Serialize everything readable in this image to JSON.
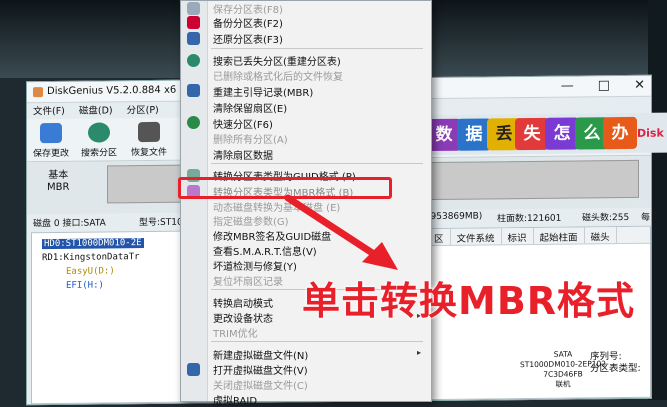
{
  "window": {
    "title": "DiskGenius V5.2.0.884 x6",
    "menus": [
      "文件(F)",
      "磁盘(D)",
      "分区(P)"
    ],
    "win_controls": [
      "—",
      "□",
      "✕"
    ]
  },
  "toolbar": {
    "buttons": [
      {
        "label": "保存更改",
        "icon": "save-icon",
        "color": "#3a7bd5"
      },
      {
        "label": "搜索分区",
        "icon": "magnifier-icon",
        "color": "#2a8a6a"
      },
      {
        "label": "恢复文件",
        "icon": "recover-icon",
        "color": "#555555"
      }
    ]
  },
  "banner": {
    "tiles": [
      {
        "text": "数",
        "color": "#8a3bb5"
      },
      {
        "text": "据",
        "color": "#2a73c9"
      },
      {
        "text": "丢",
        "color": "#e2b000"
      },
      {
        "text": "失",
        "color": "#e23a3a"
      },
      {
        "text": "怎",
        "color": "#7a3bd5"
      },
      {
        "text": "么",
        "color": "#2a9a4a"
      },
      {
        "text": "办",
        "color": "#e85a1a"
      }
    ],
    "brand": "Disk"
  },
  "disk": {
    "label_line1": "基本",
    "label_line2": "MBR"
  },
  "infoline": {
    "disk": "磁盘 0 接口:SATA",
    "model": "型号:ST100(",
    "sectors": "(953869MB)",
    "cylinders": "柱面数:121601",
    "heads": "磁头数:255",
    "more": "每"
  },
  "tree": {
    "nodes": [
      {
        "text": "HD0:ST1000DM010-2E",
        "color": "#ffffff",
        "bg": "#2255aa"
      },
      {
        "text": "RD1:KingstonDataTr",
        "color": "#000000",
        "bg": "transparent"
      },
      {
        "text": "EasyU(D:)",
        "color": "#b08a00",
        "bg": "transparent"
      },
      {
        "text": "EFI(H:)",
        "color": "#1a5ac0",
        "bg": "transparent"
      }
    ]
  },
  "panel": {
    "tabs": [
      "区",
      "文件系统",
      "标识",
      "起始柱面",
      "磁头"
    ],
    "sata_label": "SATA",
    "sata_model": "ST1000DM010-2EP102",
    "sata_serial": "7C3D46FB",
    "sata_status": "联机",
    "serial_label": "序列号:",
    "part_table_label": "分区表类型:"
  },
  "menu": {
    "items": [
      {
        "label": "保存分区表(F8)",
        "disabled": true,
        "icon": "save-icon",
        "icolor": "#9ab"
      },
      {
        "label": "备份分区表(F2)",
        "disabled": false,
        "icon": "backup-icon",
        "icolor": "#c03"
      },
      {
        "label": "还原分区表(F3)",
        "disabled": false,
        "icon": "restore-icon",
        "icolor": "#36a"
      },
      {
        "label": "搜索已丢失分区(重建分区表)",
        "disabled": false,
        "icon": "search-icon",
        "icolor": "#2a8a6a"
      },
      {
        "label": "已删除或格式化后的文件恢复",
        "disabled": true,
        "icon": "",
        "icolor": ""
      },
      {
        "label": "重建主引导记录(MBR)",
        "disabled": false,
        "icon": "mbr-icon",
        "icolor": "#36a"
      },
      {
        "label": "清除保留扇区(E)",
        "disabled": false,
        "icon": "",
        "icolor": ""
      },
      {
        "label": "快速分区(F6)",
        "disabled": false,
        "icon": "quick-partition-icon",
        "icolor": "#2a8a4a"
      },
      {
        "label": "删除所有分区(A)",
        "disabled": true,
        "icon": "",
        "icolor": ""
      },
      {
        "label": "清除扇区数据",
        "disabled": false,
        "icon": "",
        "icolor": ""
      },
      {
        "label": "转换分区表类型为GUID格式 (P)",
        "disabled": false,
        "icon": "convert-icon",
        "icolor": "#7a9"
      },
      {
        "label": "转换分区表类型为MBR格式 (B)",
        "disabled": true,
        "icon": "convert-icon",
        "icolor": "#b7c"
      },
      {
        "label": "动态磁盘转换为基本磁盘 (E)",
        "disabled": true,
        "icon": "",
        "icolor": ""
      },
      {
        "label": "指定磁盘参数(G)",
        "disabled": true,
        "icon": "",
        "icolor": ""
      },
      {
        "label": "修改MBR签名及GUID磁盘",
        "disabled": false,
        "icon": "",
        "icolor": ""
      },
      {
        "label": "查看S.M.A.R.T.信息(V)",
        "disabled": false,
        "icon": "",
        "icolor": ""
      },
      {
        "label": "坏道检测与修复(Y)",
        "disabled": false,
        "icon": "",
        "icolor": ""
      },
      {
        "label": "复位坏扇区记录",
        "disabled": true,
        "icon": "",
        "icolor": ""
      },
      {
        "label": "转换启动模式",
        "disabled": false,
        "icon": "",
        "icolor": ""
      },
      {
        "label": "更改设备状态",
        "disabled": false,
        "icon": "",
        "icolor": ""
      },
      {
        "label": "TRIM优化",
        "disabled": true,
        "icon": "",
        "icolor": ""
      },
      {
        "label": "新建虚拟磁盘文件(N)",
        "disabled": false,
        "icon": "",
        "icolor": ""
      },
      {
        "label": "打开虚拟磁盘文件(V)",
        "disabled": false,
        "icon": "open-vdisk-icon",
        "icolor": "#36a"
      },
      {
        "label": "关闭虚拟磁盘文件(C)",
        "disabled": true,
        "icon": "",
        "icolor": ""
      },
      {
        "label": "虚拟RAID",
        "disabled": false,
        "icon": "",
        "icolor": ""
      }
    ]
  },
  "annotation": {
    "callout": "单击转换MBR格式",
    "color": "#e8202a"
  }
}
